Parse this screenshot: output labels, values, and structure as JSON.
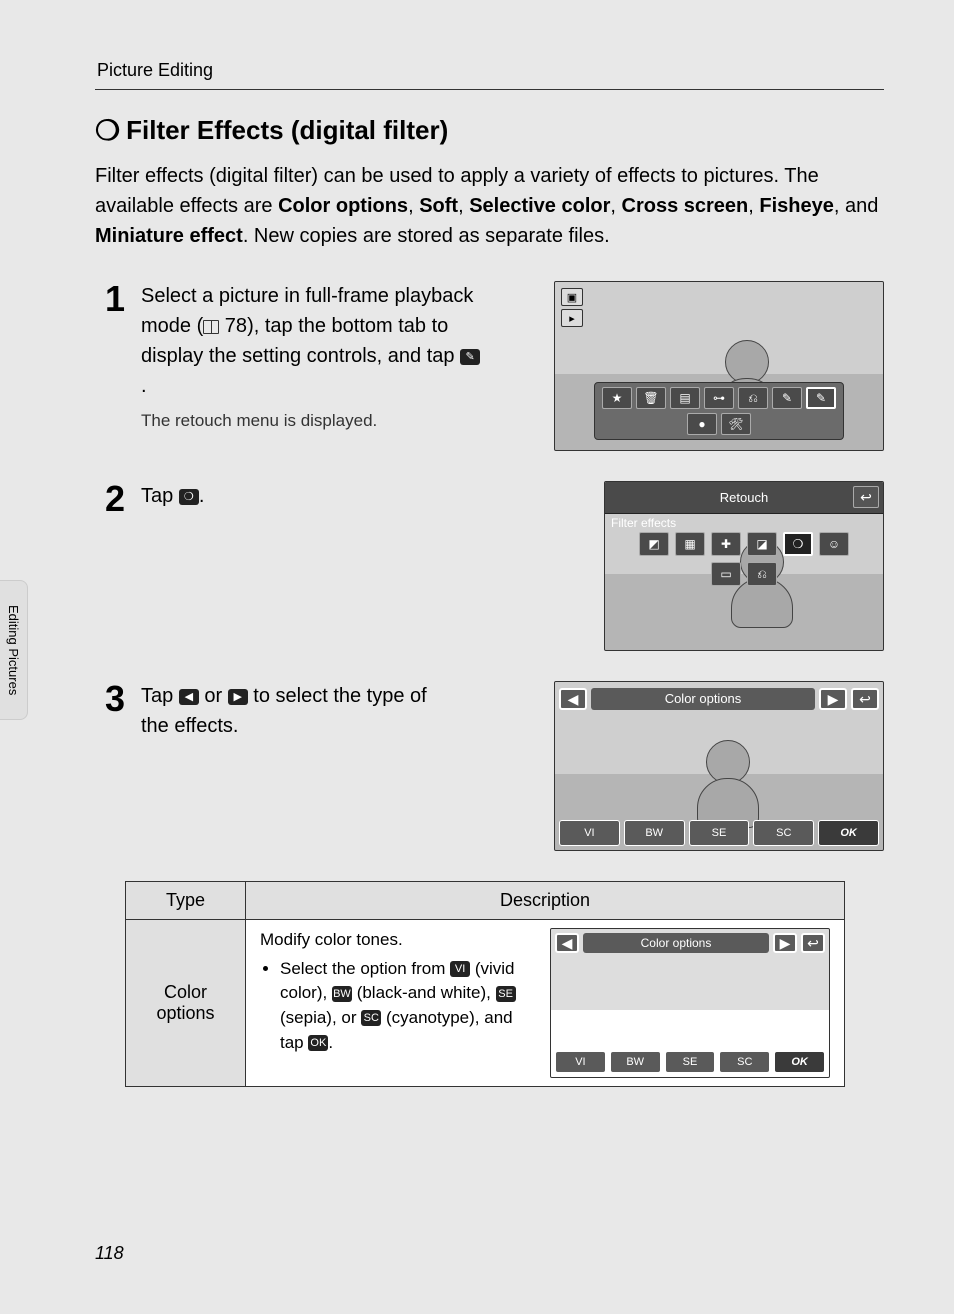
{
  "header": {
    "section": "Picture Editing"
  },
  "title": {
    "glyph": "❍",
    "text": "Filter Effects (digital filter)"
  },
  "intro": {
    "pre": "Filter effects (digital filter) can be used to apply a variety of effects to pictures. The available effects are ",
    "e1": "Color options",
    "c1": ", ",
    "e2": "Soft",
    "c2": ", ",
    "e3": "Selective color",
    "c3": ", ",
    "e4": "Cross screen",
    "c4": ", ",
    "e5": "Fisheye",
    "c5": ", and ",
    "e6": "Miniature effect",
    "post": ". New copies are stored as separate files."
  },
  "steps": {
    "s1": {
      "num": "1",
      "text_a": "Select a picture in full-frame playback mode (",
      "page_ref": " 78",
      "text_b": "), tap the bottom tab to display the setting controls, and tap ",
      "icon_label": "✎",
      "text_c": ".",
      "sub": "The retouch menu is displayed."
    },
    "s2": {
      "num": "2",
      "text_a": "Tap ",
      "icon_label": "❍",
      "text_b": "."
    },
    "s3": {
      "num": "3",
      "text_a": "Tap ",
      "left_icon": "◀",
      "text_b": " or ",
      "right_icon": "▶",
      "text_c": " to select the type of the effects."
    }
  },
  "figures": {
    "f1": {
      "corner_cam": "▣",
      "corner_play": "▸",
      "icons": [
        "★",
        "🗑",
        "▤",
        "⊶",
        "⎌",
        "✎",
        "✎",
        "●",
        "🛠"
      ],
      "selected_index": 6
    },
    "f2": {
      "title": "Retouch",
      "subtitle": "Filter effects",
      "back": "↩",
      "opts": [
        "◩",
        "▦",
        "✚",
        "◪",
        "❍",
        "☺",
        "▭",
        "⎌"
      ],
      "selected_index": 4
    },
    "f3": {
      "left": "◀",
      "label": "Color options",
      "right": "▶",
      "back": "↩",
      "bottom": [
        "VI",
        "BW",
        "SE",
        "SC"
      ],
      "ok": "OK"
    },
    "f4": {
      "left": "◀",
      "label": "Color options",
      "right": "▶",
      "back": "↩",
      "bottom": [
        "VI",
        "BW",
        "SE",
        "SC"
      ],
      "ok": "OK"
    }
  },
  "table": {
    "h1": "Type",
    "h2": "Description",
    "row1": {
      "type": "Color options",
      "l1": "Modify color tones.",
      "b1a": "Select the option from ",
      "vi": "VI",
      "vi_t": " (vivid color), ",
      "bw": "BW",
      "bw_t": " (black-and white), ",
      "se": "SE",
      "se_t": " (sepia), or ",
      "sc": "SC",
      "sc_t": " (cyanotype), and tap ",
      "ok": "OK",
      "ok_t": "."
    }
  },
  "side_tab": "Editing Pictures",
  "page_number": "118"
}
